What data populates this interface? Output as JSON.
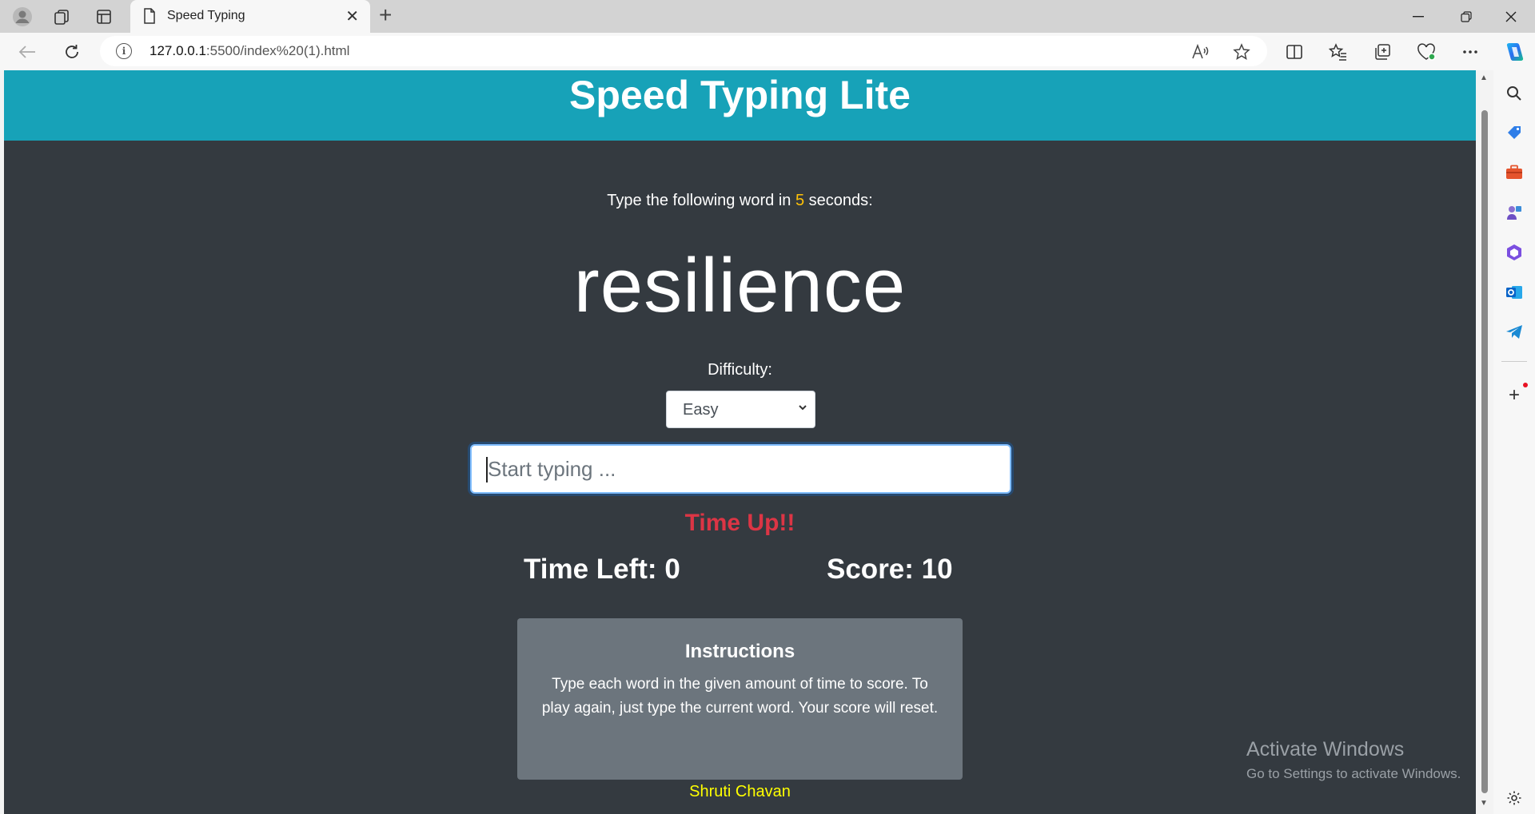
{
  "browser": {
    "tab_title": "Speed Typing",
    "url_host": "127.0.0.1",
    "url_rest": ":5500/index%20(1).html"
  },
  "page": {
    "title": "Speed Typing Lite",
    "prompt_before": "Type the following word in ",
    "prompt_seconds": "5",
    "prompt_after": " seconds:",
    "current_word": "resilience",
    "difficulty_label": "Difficulty:",
    "difficulty_selected": "Easy",
    "input_placeholder": "Start typing ...",
    "message": "Time Up!!",
    "time_left": "Time Left: 0",
    "score": "Score: 10",
    "instructions": {
      "title": "Instructions",
      "body": "Type each word in the given amount of time to score. To play again, just type the current word. Your score will reset."
    },
    "author": "Shruti Chavan"
  },
  "os_watermark": {
    "title": "Activate Windows",
    "subtitle": "Go to Settings to activate Windows."
  },
  "colors": {
    "header": "#17a2b8",
    "background": "#343a40",
    "message": "#dc3545",
    "seconds": "#ffc107",
    "author": "#ffff00",
    "instructions_bg": "#6c757d"
  },
  "icons": {
    "tabbar": [
      "profile-icon",
      "workspaces-icon",
      "tab-actions-icon",
      "page-icon",
      "close-icon",
      "new-tab-icon"
    ],
    "toolbar": [
      "back-icon",
      "refresh-icon",
      "info-icon",
      "read-aloud-icon",
      "favorite-star-icon",
      "split-screen-icon",
      "favorites-icon",
      "collections-icon",
      "browser-essentials-icon",
      "more-icon",
      "copilot-icon"
    ],
    "sidebar": [
      "search-icon",
      "shopping-icon",
      "tools-icon",
      "games-icon",
      "microsoft365-icon",
      "outlook-icon",
      "telegram-icon",
      "add-icon",
      "settings-icon"
    ]
  }
}
